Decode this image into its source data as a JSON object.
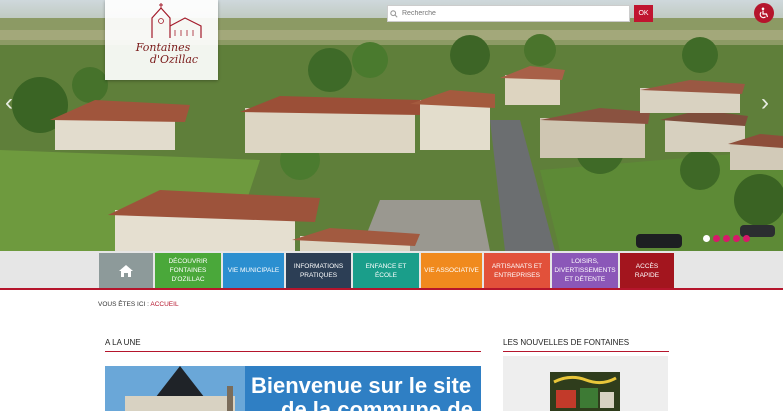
{
  "header": {
    "logo_line1": "Fontaines",
    "logo_line2": "d'Ozillac",
    "search_placeholder": "Recherche",
    "search_button": "OK"
  },
  "slider": {
    "slides": 5,
    "active": 0
  },
  "nav": {
    "items": [
      {
        "label": "",
        "color": "#8d9a9a"
      },
      {
        "label": "DÉCOUVRIR FONTAINES D'OZILLAC",
        "color": "#4aa83a"
      },
      {
        "label": "VIE MUNICIPALE",
        "color": "#2b8fd0"
      },
      {
        "label": "INFORMATIONS PRATIQUES",
        "color": "#2c3e55"
      },
      {
        "label": "ENFANCE ET ÉCOLE",
        "color": "#1a9e8a"
      },
      {
        "label": "VIE ASSOCIATIVE",
        "color": "#f08a1e"
      },
      {
        "label": "ARTISANATS ET ENTREPRISES",
        "color": "#e2513a"
      },
      {
        "label": "LOISIRS, DIVERTISSEMENTS ET DÉTENTE",
        "color": "#8b57b8"
      },
      {
        "label": "ACCÈS RAPIDE",
        "color": "#a3151e"
      }
    ]
  },
  "breadcrumb": {
    "prefix": "VOUS ÊTES ICI :",
    "current": "ACCUEIL"
  },
  "main": {
    "une_title": "A LA UNE",
    "welcome_line1": "Bienvenue sur le site",
    "welcome_line2": "de la commune de"
  },
  "sidebar": {
    "news_title": "LES NOUVELLES DE FONTAINES"
  },
  "colors": {
    "accent": "#b5152c"
  }
}
